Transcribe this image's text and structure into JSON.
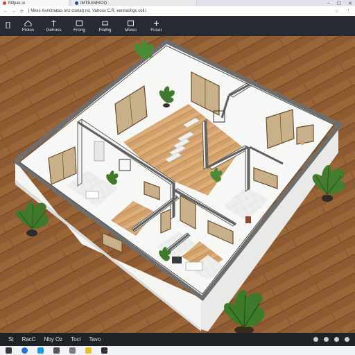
{
  "browser": {
    "tab1_title": "Mitpas io",
    "tab2_title": "IMTEANRIOO",
    "address": "| Mkes Kenctnatas onz clonat) nd. Vanoux C.R. eennashgc coll.l"
  },
  "toolbar": {
    "items": [
      {
        "label": ""
      },
      {
        "label": "Flolos"
      },
      {
        "label": "Gehoss"
      },
      {
        "label": "Frong"
      },
      {
        "label": "Flathg"
      },
      {
        "label": "Mixes"
      },
      {
        "label": "Fuser"
      }
    ]
  },
  "statusbar": {
    "items": [
      "St",
      "RacC",
      "Nby Oz",
      "Tocl",
      "Tavo"
    ]
  },
  "colors": {
    "toolbar_bg": "#272b31",
    "floor_wood": "#8a5a33",
    "wall_white": "#f1f1ef",
    "wall_cap": "#6b6b6b"
  }
}
